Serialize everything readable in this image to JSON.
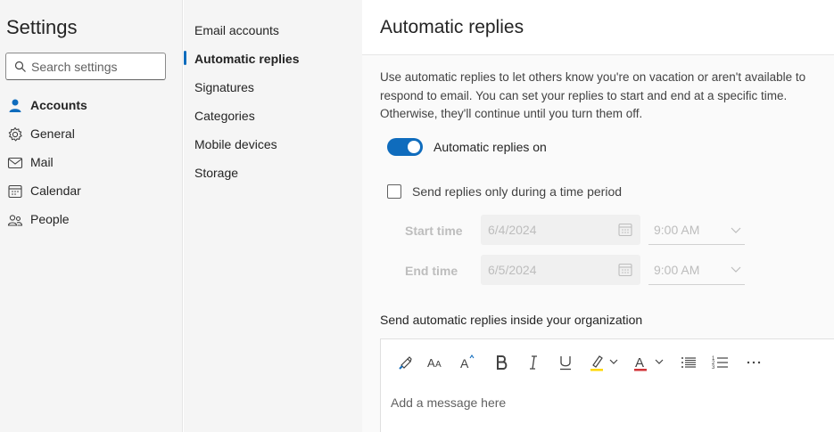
{
  "sidebar": {
    "title": "Settings",
    "search_placeholder": "Search settings",
    "items": [
      {
        "label": "Accounts",
        "icon": "person-icon",
        "active": true
      },
      {
        "label": "General",
        "icon": "gear-icon"
      },
      {
        "label": "Mail",
        "icon": "mail-icon"
      },
      {
        "label": "Calendar",
        "icon": "calendar-icon"
      },
      {
        "label": "People",
        "icon": "people-icon"
      }
    ]
  },
  "subnav": {
    "items": [
      {
        "label": "Email accounts"
      },
      {
        "label": "Automatic replies",
        "active": true
      },
      {
        "label": "Signatures"
      },
      {
        "label": "Categories"
      },
      {
        "label": "Mobile devices"
      },
      {
        "label": "Storage"
      }
    ]
  },
  "main": {
    "title": "Automatic replies",
    "description": "Use automatic replies to let others know you're on vacation or aren't available to respond to email. You can set your replies to start and end at a specific time. Otherwise, they'll continue until you turn them off.",
    "toggle": {
      "label": "Automatic replies on",
      "on": true
    },
    "time_period_checkbox": {
      "label": "Send replies only during a time period",
      "checked": false
    },
    "start": {
      "label": "Start time",
      "date": "6/4/2024",
      "time": "9:00 AM"
    },
    "end": {
      "label": "End time",
      "date": "6/5/2024",
      "time": "9:00 AM"
    },
    "org_label": "Send automatic replies inside your organization",
    "editor": {
      "placeholder": "Add a message here",
      "toolbar": [
        "format-painter-icon",
        "font-size-icon",
        "grow-font-icon",
        "bold-icon",
        "italic-icon",
        "underline-icon",
        "highlight-icon",
        "font-color-icon",
        "bullets-icon",
        "numbering-icon",
        "more-options-icon"
      ],
      "highlight_color": "#ffd700",
      "font_color": "#d13438"
    }
  },
  "colors": {
    "accent": "#0f6cbd"
  }
}
